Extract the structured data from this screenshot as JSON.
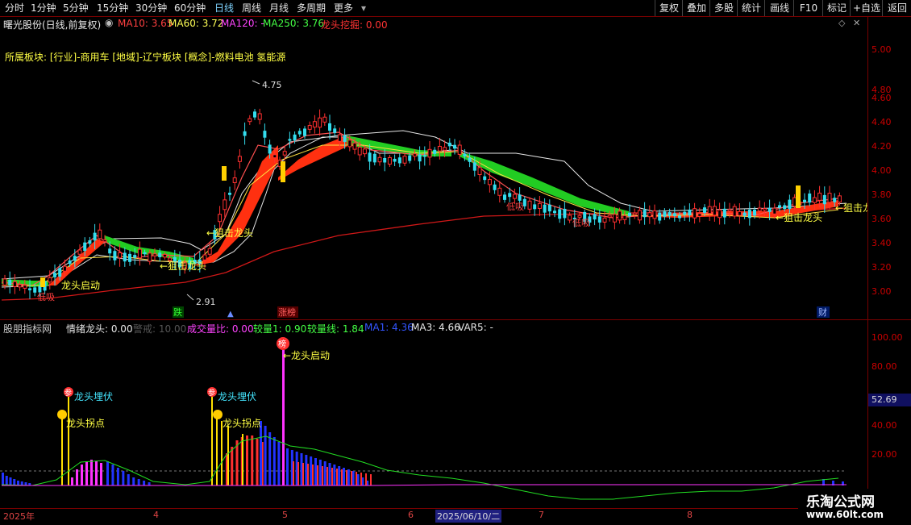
{
  "toolbar": {
    "periods": [
      "分时",
      "1分钟",
      "5分钟",
      "15分钟",
      "30分钟",
      "60分钟",
      "日线",
      "周线",
      "月线",
      "多周期",
      "更多"
    ],
    "active_period": "日线",
    "right_buttons": [
      "复权",
      "叠加",
      "多股",
      "统计",
      "画线",
      "F10",
      "标记",
      "+自选",
      "返回"
    ]
  },
  "main_header": {
    "stock": "曙光股份(日线,前复权)",
    "ma10": "MA10: 3.65",
    "ma60": "MA60: 3.72",
    "ma120": "MA120: -",
    "ma250": "MA250: 3.76",
    "dragon": "龙头挖掘: 0.00",
    "sector": "所属板块: [行业]-商用车 [地域]-辽宁板块 [概念]-燃料电池 氢能源"
  },
  "main_axis": [
    "5.00",
    "4.80",
    "4.60",
    "4.40",
    "4.20",
    "4.00",
    "3.80",
    "3.60",
    "3.40",
    "3.20",
    "3.00"
  ],
  "main_annotations": {
    "high": "4.75",
    "low": "2.91",
    "dragon_start": "龙头启动",
    "low_buy_1": "低吸",
    "snipe_1": "←狙击龙头",
    "snipe_2": "←狙击龙头",
    "low_buy_2": "低吸",
    "low_buy_3": "低吸",
    "snipe_3": "←狙击龙头",
    "snipe_4": "←狙击龙",
    "marker_fall": "跌",
    "marker_limit": "涨榜",
    "marker_fin": "财"
  },
  "sub_header": {
    "name": "股朋指标网",
    "mood": "情绪龙头: 0.00",
    "warn": "警戒: 10.00",
    "vol_ratio": "成交量比: 0.00",
    "vol1": "较量1: 0.90",
    "vol_line": "较量线: 1.84",
    "ma1": "MA1: 4.36",
    "ma3": "MA3: 4.66",
    "var5": "VAR5: -"
  },
  "sub_axis": [
    "100.00",
    "80.00",
    "60.00",
    "40.00",
    "20.00"
  ],
  "sub_current": "52.69",
  "sub_annotations": {
    "ambush_1": "龙头埋伏",
    "turn_1": "龙头拐点",
    "ambush_2": "龙头埋伏",
    "turn_2": "龙头拐点",
    "start": "←龙头启动",
    "badge_can": "参",
    "badge_bang": "榜"
  },
  "x_labels": {
    "year": "2025年",
    "m4": "4",
    "m5": "5",
    "m6": "6",
    "cursor_date": "2025/06/10/二",
    "m7": "7",
    "m8": "8"
  },
  "watermark": {
    "name": "乐淘公式网",
    "url": "www.60lt.com"
  }
}
